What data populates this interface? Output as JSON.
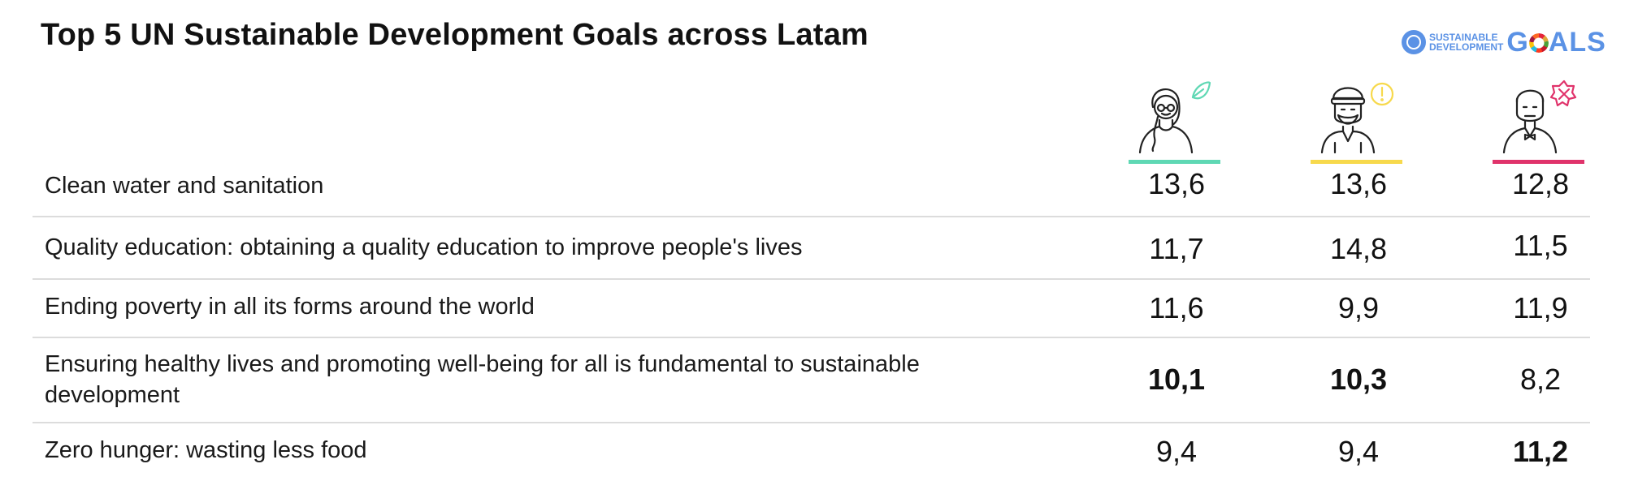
{
  "chart_data": {
    "type": "table",
    "title": "Top 5 UN Sustainable Development Goals across Latam",
    "columns": [
      {
        "icon": "woman-leaf-persona-icon",
        "color": "#5fd8b4"
      },
      {
        "icon": "man-warning-persona-icon",
        "color": "#f7d94c"
      },
      {
        "icon": "man-cross-persona-icon",
        "color": "#e0336b"
      }
    ],
    "rows": [
      {
        "label": "Clean water and sanitation",
        "values": [
          "13,6",
          "13,6",
          "12,8"
        ],
        "bold": [
          false,
          false,
          false
        ]
      },
      {
        "label": "Quality education: obtaining a quality education to improve people's lives",
        "values": [
          "11,7",
          "14,8",
          "11,5"
        ],
        "bold": [
          false,
          false,
          false
        ]
      },
      {
        "label": "Ending poverty in all its forms around the world",
        "values": [
          "11,6",
          "9,9",
          "11,9"
        ],
        "bold": [
          false,
          false,
          false
        ]
      },
      {
        "label": "Ensuring healthy lives and promoting well-being for all is fundamental to sustainable development",
        "values": [
          "10,1",
          "10,3",
          "8,2"
        ],
        "bold": [
          true,
          true,
          false
        ]
      },
      {
        "label": "Zero hunger: wasting less food",
        "values": [
          "9,4",
          "9,4",
          "11,2"
        ],
        "bold": [
          false,
          false,
          true
        ]
      }
    ]
  },
  "logo": {
    "line1": "SUSTAINABLE",
    "line2": "DEVELOPMENT",
    "goals_g": "G",
    "goals_rest": "ALS"
  }
}
